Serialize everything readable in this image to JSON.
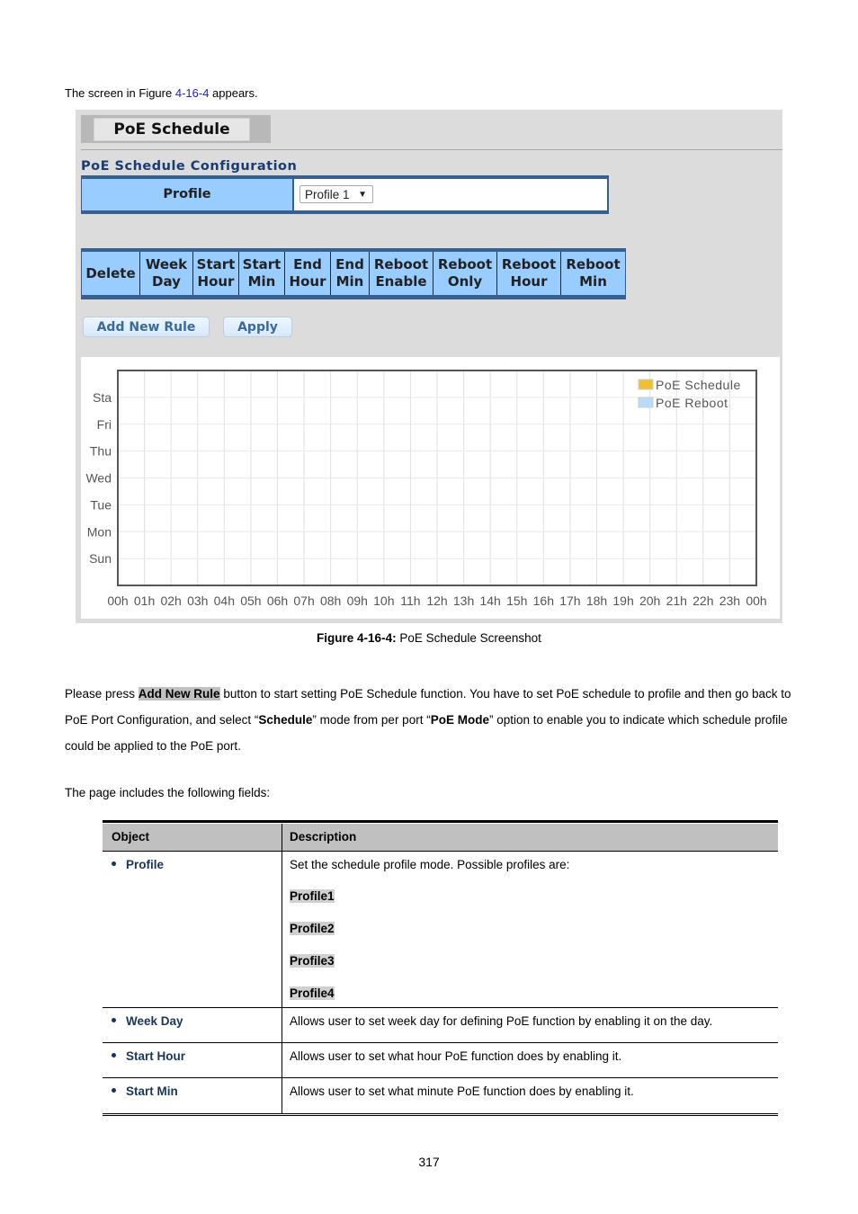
{
  "intro": {
    "prefix": "The screen in Figure ",
    "link": "4-16-4",
    "suffix": " appears."
  },
  "ui": {
    "tab_title": "PoE Schedule",
    "section_title": "PoE Schedule Configuration",
    "profile_label": "Profile",
    "profile_select": {
      "value": "Profile 1",
      "arrow": "▼"
    },
    "rule_columns": [
      [
        "Delete"
      ],
      [
        "Week",
        "Day"
      ],
      [
        "Start",
        "Hour"
      ],
      [
        "Start",
        "Min"
      ],
      [
        "End",
        "Hour"
      ],
      [
        "End",
        "Min"
      ],
      [
        "Reboot",
        "Enable"
      ],
      [
        "Reboot",
        "Only"
      ],
      [
        "Reboot",
        "Hour"
      ],
      [
        "Reboot",
        "Min"
      ]
    ],
    "buttons": {
      "add_new_rule": "Add New Rule",
      "apply": "Apply"
    },
    "colors": {
      "header_blue": "#99ccff",
      "border_blue": "#36608f",
      "title_blue": "#1a3c73"
    }
  },
  "chart_data": {
    "type": "heatmap",
    "title": "",
    "xlabel": "",
    "ylabel": "",
    "x_ticks": [
      "00h",
      "01h",
      "02h",
      "03h",
      "04h",
      "05h",
      "06h",
      "07h",
      "08h",
      "09h",
      "10h",
      "11h",
      "12h",
      "13h",
      "14h",
      "15h",
      "16h",
      "17h",
      "18h",
      "19h",
      "20h",
      "21h",
      "22h",
      "23h",
      "00h"
    ],
    "y_ticks": [
      "Sta",
      "Fri",
      "Thu",
      "Wed",
      "Tue",
      "Mon",
      "Sun"
    ],
    "xlim": [
      0,
      24
    ],
    "grid": true,
    "legend": {
      "placement": "top-right",
      "entries": [
        {
          "name": "PoE Schedule",
          "color": "#f0c030"
        },
        {
          "name": "PoE Reboot",
          "color": "#b8dcf8"
        }
      ]
    },
    "series": [
      {
        "name": "PoE Schedule",
        "values": []
      },
      {
        "name": "PoE Reboot",
        "values": []
      }
    ]
  },
  "caption": {
    "label": "Figure 4-16-4:",
    "text": " PoE Schedule Screenshot"
  },
  "paragraph": {
    "p1": "Please press ",
    "hl": "Add New Rule",
    "p2": " button to start setting PoE Schedule function. You have to set PoE schedule to profile and then go back to PoE Port Configuration, and select “",
    "b1": "Schedule",
    "p3": "” mode from per port “",
    "b2": "PoE Mode",
    "p4": "” option to enable you to indicate which schedule profile could be applied to the PoE port."
  },
  "fields_intro": "The page includes the following fields:",
  "fields_table": {
    "headers": {
      "object": "Object",
      "description": "Description"
    },
    "rows": [
      {
        "object": "Profile",
        "description": "Set the schedule profile mode. Possible profiles are:",
        "options": [
          "Profile1",
          "Profile2",
          "Profile3",
          "Profile4"
        ]
      },
      {
        "object": "Week Day",
        "description": "Allows user to set week day for defining PoE function by enabling it on the day."
      },
      {
        "object": "Start Hour",
        "description": "Allows user to set what hour PoE function does by enabling it."
      },
      {
        "object": "Start Min",
        "description": "Allows user to set what minute PoE function does by enabling it."
      }
    ]
  },
  "page_number": "317"
}
